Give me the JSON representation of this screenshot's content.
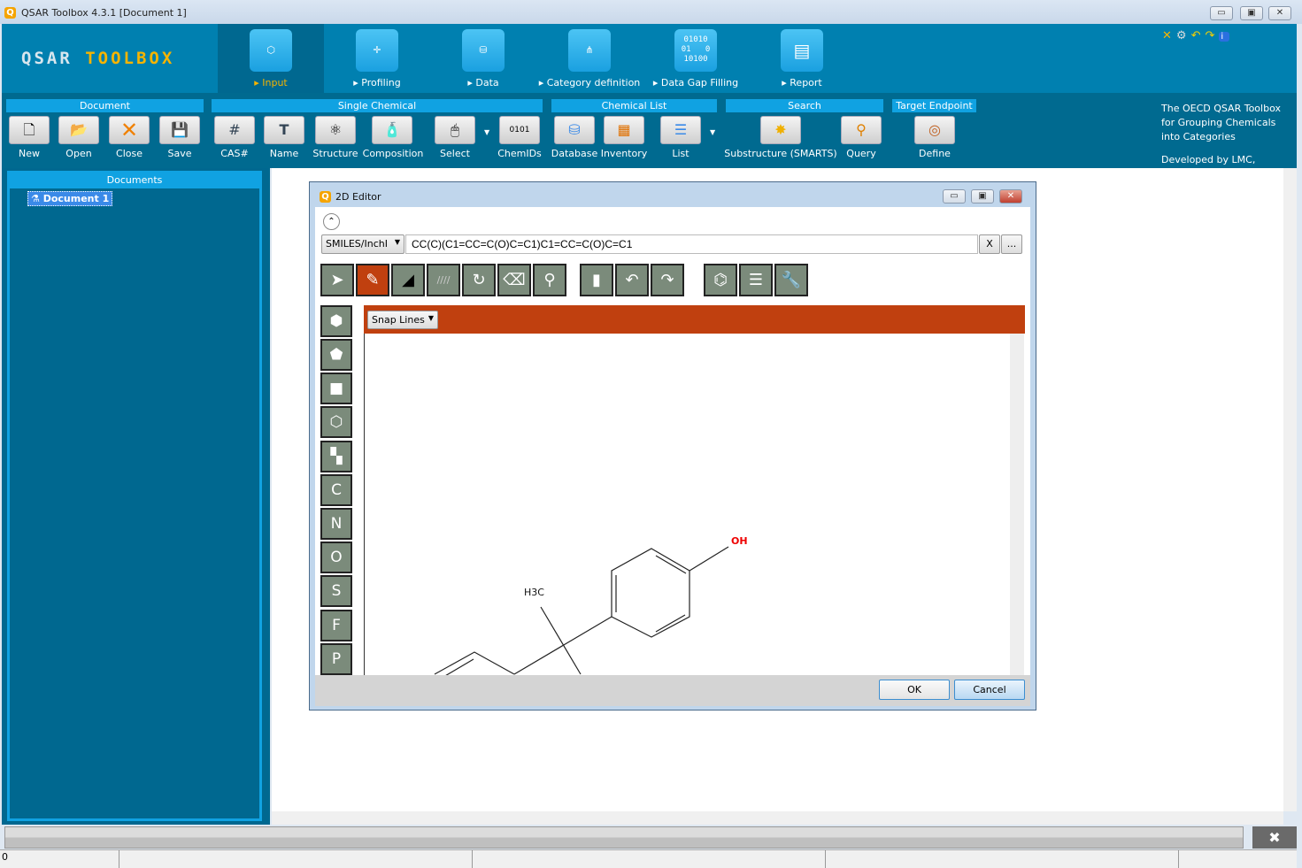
{
  "window": {
    "title": "QSAR Toolbox 4.3.1 [Document 1]",
    "minimize": "▭",
    "restore": "▣",
    "close": "✕"
  },
  "logo": {
    "part1": "QSAR ",
    "part2": "TOOLBOX"
  },
  "workflow_tabs": [
    {
      "label": "Input",
      "active": true
    },
    {
      "label": "Profiling"
    },
    {
      "label": "Data"
    },
    {
      "label": "Category definition"
    },
    {
      "label": "Data Gap Filling"
    },
    {
      "label": "Report"
    }
  ],
  "data_icon_text": "01010\n01   0\n10100",
  "ribbon": {
    "groups": [
      "Document",
      "Single Chemical",
      "Chemical List",
      "Search",
      "Target Endpoint"
    ],
    "buttons": [
      "New",
      "Open",
      "Close",
      "Save",
      "CAS#",
      "Name",
      "Structure",
      "Composition",
      "Select",
      "ChemIDs",
      "Database",
      "Inventory",
      "List",
      "Substructure (SMARTS)",
      "Query",
      "Define"
    ]
  },
  "credits": {
    "line1": "The OECD QSAR Toolbox",
    "line2": "for Grouping Chemicals",
    "line3": "into Categories",
    "line4": "Developed by LMC, Bulgaria"
  },
  "documents": {
    "header": "Documents",
    "items": [
      "Document 1"
    ]
  },
  "editor": {
    "title": "2D Editor",
    "format": "SMILES/InchI",
    "smiles": "CC(C)(C1=CC=C(O)C=C1)C1=CC=C(O)C=C1",
    "clear": "X",
    "more": "...",
    "snap": "Snap Lines",
    "atoms": [
      "C",
      "N",
      "O",
      "S",
      "F",
      "P"
    ],
    "labels": {
      "oh": "OH",
      "methyl": "H3C"
    },
    "ok": "OK",
    "cancel": "Cancel"
  },
  "status": {
    "value": "0"
  },
  "progress_close": "✖"
}
